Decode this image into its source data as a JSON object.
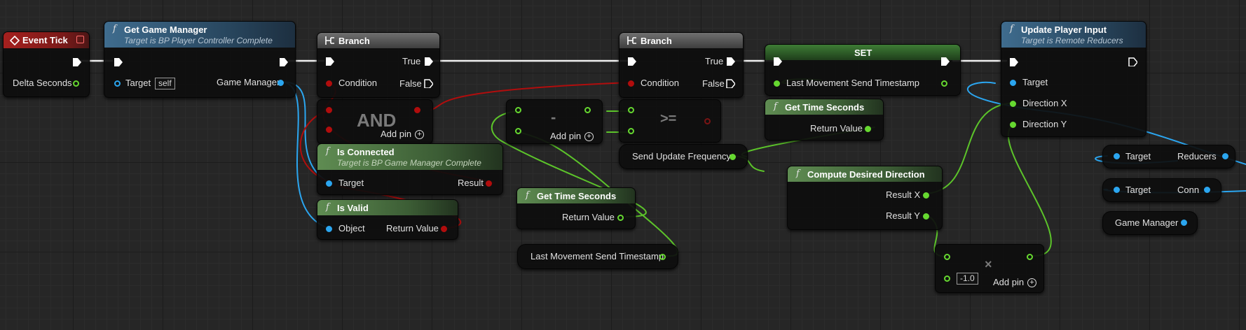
{
  "nodes": {
    "event_tick": {
      "title": "Event Tick",
      "delta_seconds": "Delta Seconds"
    },
    "get_game_manager": {
      "title": "Get Game Manager",
      "subtitle": "Target is BP Player Controller Complete",
      "target": "Target",
      "self_value": "self",
      "out": "Game Manager"
    },
    "branch1": {
      "title": "Branch",
      "condition": "Condition",
      "true": "True",
      "false": "False"
    },
    "and": {
      "op": "AND",
      "add_pin": "Add pin"
    },
    "is_connected": {
      "title": "Is Connected",
      "subtitle": "Target is BP Game Manager Complete",
      "target": "Target",
      "result": "Result"
    },
    "is_valid": {
      "title": "Is Valid",
      "object": "Object",
      "return_value": "Return Value"
    },
    "subtract": {
      "op": "-",
      "add_pin": "Add pin"
    },
    "get_time_1": {
      "title": "Get Time Seconds",
      "return_value": "Return Value"
    },
    "last_movement_var": {
      "label": "Last Movement Send Timestamp"
    },
    "branch2": {
      "title": "Branch",
      "condition": "Condition",
      "true": "True",
      "false": "False"
    },
    "gte": {
      "op": ">="
    },
    "send_update_freq": {
      "label": "Send Update Frequency"
    },
    "set": {
      "title": "SET",
      "var": "Last Movement Send Timestamp"
    },
    "get_time_2": {
      "title": "Get Time Seconds",
      "return_value": "Return Value"
    },
    "compute_dir": {
      "title": "Compute Desired Direction",
      "result_x": "Result X",
      "result_y": "Result Y"
    },
    "multiply": {
      "op": "×",
      "value": "-1.0",
      "add_pin": "Add pin"
    },
    "update_input": {
      "title": "Update Player Input",
      "subtitle": "Target is Remote Reducers",
      "target": "Target",
      "dir_x": "Direction X",
      "dir_y": "Direction Y"
    },
    "reducers": {
      "target": "Target",
      "out": "Reducers"
    },
    "conn": {
      "target": "Target",
      "out": "Conn"
    },
    "game_manager_var": {
      "label": "Game Manager"
    }
  },
  "colors": {
    "exec": "#ffffff",
    "object": "#2ba6f0",
    "float": "#66d830",
    "bool": "#b10d0d",
    "function_header": "#3f6c8e",
    "pure_header": "#5f8c52",
    "event_header": "#a5201e"
  },
  "icons": {
    "event": "event-diamond-icon",
    "function": "function-f-icon",
    "branch": "branch-icon"
  }
}
